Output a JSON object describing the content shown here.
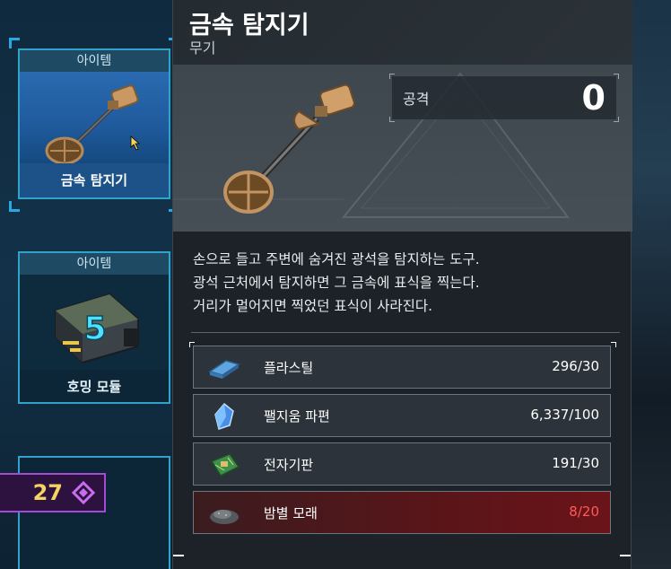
{
  "inventory": {
    "cards": [
      {
        "tag": "아이템",
        "name": "금속 탐지기"
      },
      {
        "tag": "아이템",
        "name": "호밍 모듈",
        "badge": "5"
      }
    ],
    "currency": {
      "value": "27",
      "icon": "crystal-icon",
      "color": "#a34ad6"
    }
  },
  "detail": {
    "title": "금속 탐지기",
    "subtitle": "무기",
    "stat": {
      "label": "공격",
      "value": "0"
    },
    "description": [
      "손으로 들고 주변에 숨겨진 광석을 탐지하는 도구.",
      "광석 근처에서 탐지하면 그 금속에 표식을 찍는다.",
      "거리가 멀어지면 찍었던 표식이 사라진다."
    ],
    "requirements": [
      {
        "name": "플라스틸",
        "have": "296",
        "need": "30",
        "icon": "plasteel-icon",
        "sufficient": true
      },
      {
        "name": "팰지움 파편",
        "have": "6,337",
        "need": "100",
        "icon": "palladium-shard-icon",
        "sufficient": true
      },
      {
        "name": "전자기판",
        "have": "191",
        "need": "30",
        "icon": "circuit-board-icon",
        "sufficient": true
      },
      {
        "name": "밤별 모래",
        "have": "8",
        "need": "20",
        "icon": "sand-icon",
        "sufficient": false
      }
    ]
  },
  "colors": {
    "accent": "#2fa3c9",
    "warning": "#ff5a5a",
    "highlight": "#f4d35e"
  }
}
